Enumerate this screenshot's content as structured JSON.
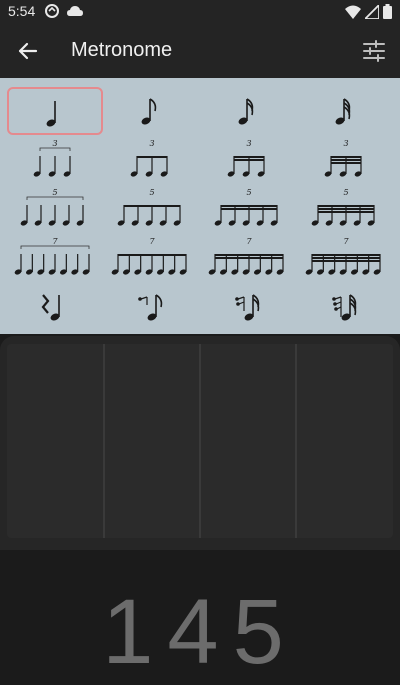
{
  "status": {
    "time": "5:54",
    "left_icons": [
      "sync-icon",
      "cloud-icon"
    ],
    "right_icons": [
      "wifi-icon",
      "signal-icon",
      "battery-icon"
    ]
  },
  "app_bar": {
    "title": "Metronome",
    "back_icon": "arrow-left-icon",
    "settings_icon": "tune-icon"
  },
  "rhythms": {
    "selected_index": 0,
    "rows": [
      [
        "quarter",
        "eighth",
        "sixteenth",
        "thirty-second"
      ],
      [
        "quarter-triplet",
        "eighth-triplet",
        "sixteenth-triplet",
        "thirty-second-triplet"
      ],
      [
        "quarter-quintuplet",
        "eighth-quintuplet",
        "sixteenth-quintuplet",
        "thirty-second-quintuplet"
      ],
      [
        "quarter-septuplet",
        "eighth-septuplet",
        "sixteenth-septuplet",
        "thirty-second-septuplet"
      ],
      [
        "quarter-rest-note",
        "eighth-rest-note",
        "sixteenth-rest-note",
        "thirty-second-rest-note"
      ]
    ],
    "tuplet_labels": [
      "3",
      "5",
      "7"
    ]
  },
  "beats": {
    "count": 4
  },
  "bpm": {
    "value": "145"
  },
  "colors": {
    "background": "#1b1b1b",
    "toolbar": "#242424",
    "panel": "#b8c6ce",
    "selected_border": "#e58a8e",
    "bpm_text": "#6c6c6c"
  }
}
